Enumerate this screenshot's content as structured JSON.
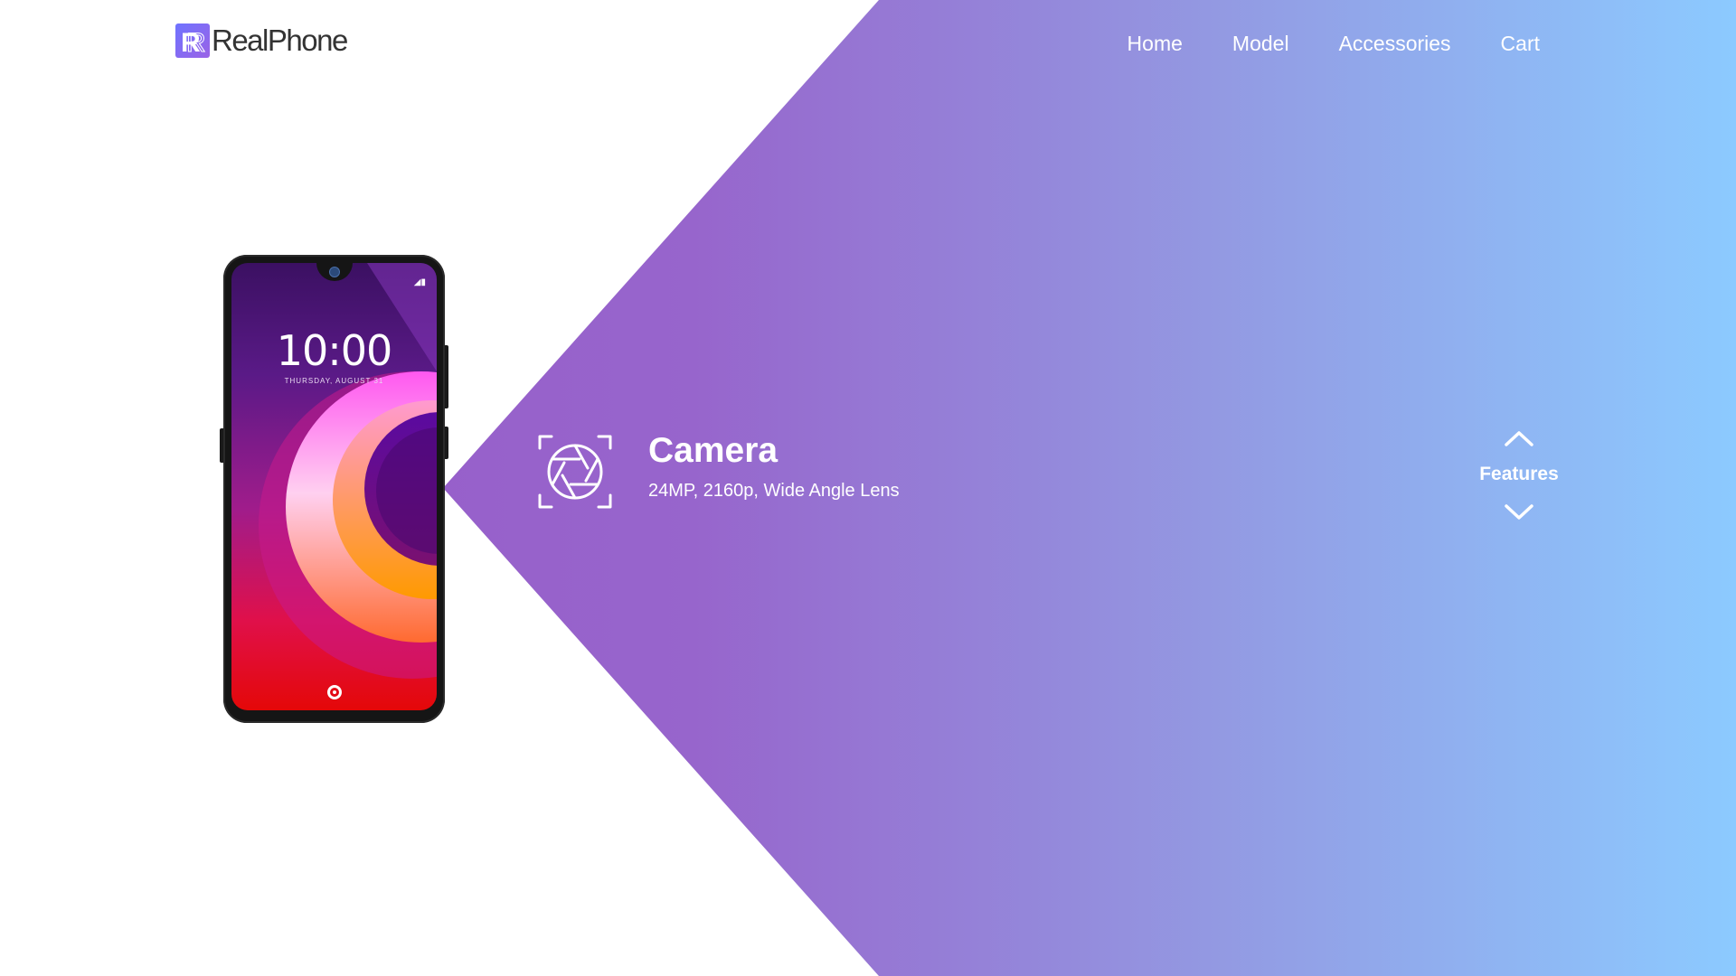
{
  "brand": {
    "name": "RealPhone",
    "logo_letter": "R",
    "logo_icon": "realphone-logo-icon"
  },
  "nav": {
    "items": [
      {
        "label": "Home"
      },
      {
        "label": "Model"
      },
      {
        "label": "Accessories"
      },
      {
        "label": "Cart"
      }
    ]
  },
  "phone": {
    "time": "10:00",
    "date": "THURSDAY, AUGUST 31"
  },
  "feature": {
    "icon": "camera-aperture-icon",
    "title": "Camera",
    "description": "24MP, 2160p, Wide Angle Lens"
  },
  "features_nav": {
    "label": "Features",
    "up_icon": "chevron-up-icon",
    "down_icon": "chevron-down-icon"
  },
  "colors": {
    "gradient_start": "#9758c8",
    "gradient_end": "#8ccaff",
    "logo_text": "#333333",
    "text_on_gradient": "#ffffff"
  }
}
